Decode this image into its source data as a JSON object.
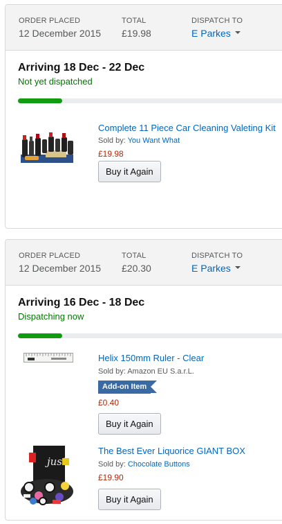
{
  "orders": [
    {
      "header": {
        "placed_label": "ORDER PLACED",
        "placed_value": "12 December 2015",
        "total_label": "TOTAL",
        "total_value": "£19.98",
        "dispatch_label": "DISPATCH TO",
        "dispatch_value": "E Parkes"
      },
      "arriving": "Arriving 18 Dec - 22 Dec",
      "status": "Not yet dispatched",
      "status_color": "#007600",
      "progress_fraction": 0.16,
      "items": [
        {
          "title": "Complete 11 Piece Car Cleaning Valeting Kit",
          "sold_by_label": "Sold by:",
          "seller": "You Want What",
          "price": "£19.98",
          "button": "Buy it Again"
        }
      ]
    },
    {
      "header": {
        "placed_label": "ORDER PLACED",
        "placed_value": "12 December 2015",
        "total_label": "TOTAL",
        "total_value": "£20.30",
        "dispatch_label": "DISPATCH TO",
        "dispatch_value": "E Parkes"
      },
      "arriving": "Arriving 16 Dec - 18 Dec",
      "status": "Dispatching now",
      "status_color": "#007600",
      "progress_fraction": 0.16,
      "items": [
        {
          "title": "Helix 150mm Ruler - Clear",
          "sold_by_label": "Sold by:",
          "seller": "Amazon EU S.a.r.L.",
          "badge": "Add-on Item",
          "price": "£0.40",
          "button": "Buy it Again"
        },
        {
          "title": "The Best Ever Liquorice GIANT BOX",
          "sold_by_label": "Sold by:",
          "seller": "Chocolate Buttons",
          "price": "£19.90",
          "button": "Buy it Again"
        }
      ]
    }
  ]
}
